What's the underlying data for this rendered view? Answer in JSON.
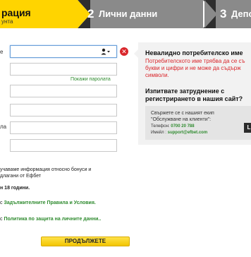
{
  "steps": {
    "step1_title": "рация",
    "step1_sub": "унта",
    "step2_num": "2",
    "step2_label": "Лични данни",
    "step3_num": "3",
    "step3_label": "Депо"
  },
  "form": {
    "label_username": "е",
    "label_fourth": "ла",
    "show_password": "Покажи паролата",
    "error_icon": "✕"
  },
  "help_panel": {
    "error_title": "Невалидно потребителско име",
    "error_text": "Потребителското име трябва да се съ букви и цифри и не може да съдърж символи.",
    "help_title": "Изпитвате затруднение с регистрирането в нашия сайт?",
    "contact_text": "Свържете се с нашият екип \"Обслужване на клиенти\":",
    "phone_label": "Телефон:",
    "phone_value": "0700 20 788",
    "email_label": "Имейл :",
    "email_value": "support@efbet.com",
    "chat_label": "L"
  },
  "consents": {
    "line1": "учаваме информация относно бонуси и",
    "line2": "длагани от Ефбет",
    "age_text": "н 18 години.",
    "terms_prefix": "с ",
    "terms_link": "Задължителните Правила и Условия.",
    "privacy_prefix": "с ",
    "privacy_link": "Политика по защита на личните данни.."
  },
  "continue_label": "ПРОДЪЛЖЕТЕ"
}
